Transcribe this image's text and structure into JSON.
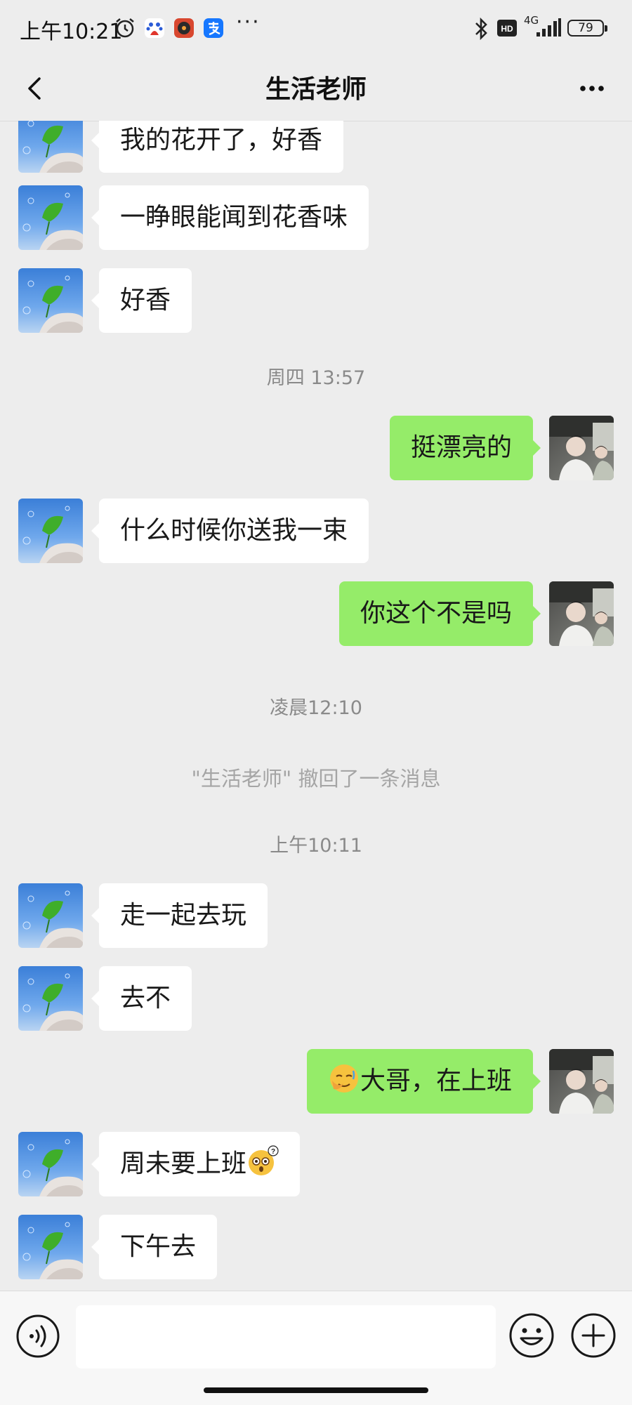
{
  "status_bar": {
    "time": "上午10:21",
    "more": "···",
    "network": "4G",
    "battery": "79",
    "icons": [
      "alarm-icon",
      "baidu-icon",
      "music-app-icon",
      "alipay-icon",
      "bluetooth-icon",
      "hd-icon",
      "signal-icon",
      "battery-icon"
    ]
  },
  "header": {
    "title": "生活老师",
    "back_icon": "chevron-left-icon",
    "more_icon": "more-dots-icon"
  },
  "messages": [
    {
      "side": "left",
      "text": "我的花开了，好香"
    },
    {
      "side": "left",
      "text": "一睁眼能闻到花香味"
    },
    {
      "side": "left",
      "text": "好香"
    },
    {
      "type": "time",
      "text": "周四 13:57"
    },
    {
      "side": "right",
      "text": "挺漂亮的"
    },
    {
      "side": "left",
      "text": "什么时候你送我一束"
    },
    {
      "side": "right",
      "text": "你这个不是吗"
    },
    {
      "type": "time",
      "text": "凌晨12:10"
    },
    {
      "type": "system",
      "text": "\"生活老师\" 撤回了一条消息"
    },
    {
      "type": "time",
      "text": "上午10:11"
    },
    {
      "side": "left",
      "text": "走一起去玩"
    },
    {
      "side": "left",
      "text": "去不"
    },
    {
      "side": "right",
      "emoji_before": "facepalm-emoji",
      "text": "大哥，在上班"
    },
    {
      "side": "left",
      "text": "周未要上班",
      "emoji_after": "confused-emoji"
    },
    {
      "side": "left",
      "text": "下午去"
    }
  ],
  "input_bar": {
    "input_value": "",
    "voice_icon": "voice-icon",
    "emoji_icon": "smiley-icon",
    "plus_icon": "plus-circle-icon"
  },
  "colors": {
    "background": "#ededed",
    "bubble_self": "#95ec69",
    "bubble_other": "#ffffff"
  }
}
